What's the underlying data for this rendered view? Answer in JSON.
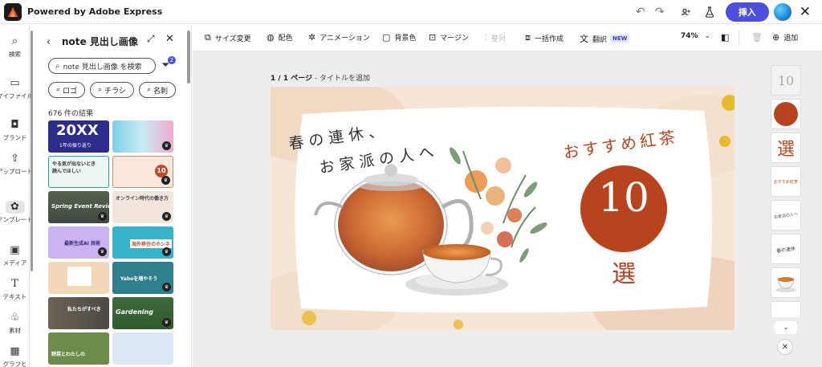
{
  "app": {
    "title": "Powered by Adobe Express"
  },
  "topbar": {
    "insert_label": "挿入"
  },
  "rail": {
    "items": [
      {
        "label": "検索",
        "icon": "search-icon"
      },
      {
        "label": "マイファイル",
        "icon": "folder-icon"
      },
      {
        "label": "ブランド",
        "icon": "brand-icon"
      },
      {
        "label": "アップロード",
        "icon": "upload-icon"
      },
      {
        "label": "テンプレート",
        "icon": "template-icon"
      },
      {
        "label": "メディア",
        "icon": "media-icon"
      },
      {
        "label": "テキスト",
        "icon": "text-icon"
      },
      {
        "label": "素材",
        "icon": "elements-icon"
      },
      {
        "label": "グラフと",
        "icon": "chart-icon"
      }
    ]
  },
  "panel": {
    "title": "note 見出し画像",
    "search_placeholder": "note 見出し画像 を検索",
    "filter_count": "2",
    "chips": [
      "ロゴ",
      "チラシ",
      "名刺"
    ],
    "result_count": "676 件の結果",
    "thumbs": [
      {
        "big": "20XX",
        "text": "1年の振り返り",
        "color": "#2e2c8a"
      },
      {
        "text": "",
        "color": "#7ccfe6"
      },
      {
        "text": "やる気が出ないとき 読んでほしい",
        "color": "#eef6f2"
      },
      {
        "text": "10",
        "color": "#f3c6a8"
      },
      {
        "text": "Spring Event Review",
        "color": "#3d4a3e"
      },
      {
        "text": "オンライン時代の働き方",
        "color": "#f2e6dc"
      },
      {
        "text": "最新生成AI 技術",
        "color": "#c9b4f0"
      },
      {
        "text": "海外移住のホンネ",
        "color": "#36b3c9"
      },
      {
        "text": "",
        "color": "#f1d9b8"
      },
      {
        "text": "Yaboを増やそう",
        "color": "#2e7f8e"
      },
      {
        "text": "私たちがすべき",
        "color": "#4d4a43"
      },
      {
        "text": "Gardening",
        "color": "#2f5a2f"
      },
      {
        "text": "野菜とわたしの",
        "color": "#6c8c4a"
      },
      {
        "text": "",
        "color": "#dde7f4"
      }
    ]
  },
  "toolbar": {
    "resize": "サイズ変更",
    "color": "配色",
    "animation": "アニメーション",
    "background": "背景色",
    "margin": "マージン",
    "align": "整列",
    "bulk": "一括作成",
    "translate": "翻訳",
    "new_badge": "NEW",
    "zoom": "74%",
    "add": "追加"
  },
  "canvas": {
    "page_indicator": "1 / 1 ページ",
    "page_title_hint": " - タイトルを追加",
    "headline_line1": "春の連休、",
    "headline_line2": "お家派の人へ",
    "right_title": "おすすめ紅茶",
    "number": "10",
    "suffix": "選"
  },
  "right_rail": {
    "thumbs": [
      "10",
      "",
      "選",
      "おすすめ紅茶",
      "お家派の人へ",
      "春の連休",
      ""
    ]
  },
  "colors": {
    "accent": "#4b4fe0",
    "brand_red": "#b8431f",
    "canvas_bg": "#ededed"
  }
}
